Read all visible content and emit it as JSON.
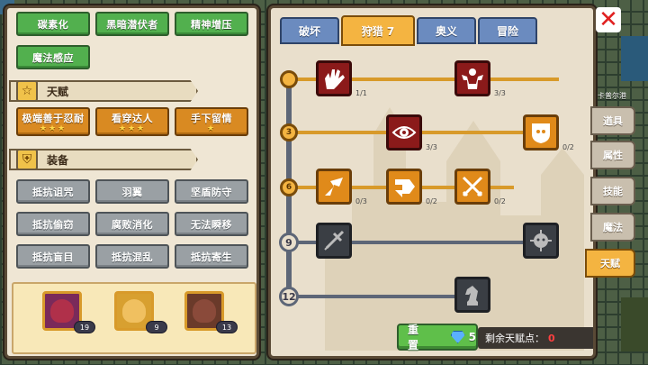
{
  "skills_top": [
    "碳素化",
    "黑暗潜伏者",
    "精神增压",
    "魔法感应"
  ],
  "talent_section": {
    "title": "天赋",
    "items": [
      {
        "label": "极端善于忍耐",
        "stars": "★★★"
      },
      {
        "label": "看穿达人",
        "stars": "★★★"
      },
      {
        "label": "手下留情",
        "stars": "★"
      }
    ]
  },
  "equip_section": {
    "title": "装备",
    "items": [
      "抵抗诅咒",
      "羽翼",
      "坚盾防守",
      "抵抗偷窃",
      "腐败消化",
      "无法瞬移",
      "抵抗盲目",
      "抵抗混乱",
      "抵抗寄生"
    ]
  },
  "heroes": [
    {
      "level": "19",
      "color": "#7a2a5a"
    },
    {
      "level": "9",
      "color": "#d8a030"
    },
    {
      "level": "13",
      "color": "#6a3a2a"
    }
  ],
  "tabs": [
    "破坏",
    "狩猎 7",
    "奥义",
    "冒险"
  ],
  "active_tab": "狩猎 7",
  "tiers": [
    "",
    "3",
    "6",
    "9",
    "12"
  ],
  "skill_ranks": {
    "t0a": "1/1",
    "t0b": "3/3",
    "t1a": "3/3",
    "t1b": "0/2",
    "t2a": "0/3",
    "t2b": "0/2",
    "t2c": "0/2"
  },
  "reset": {
    "label": "重置",
    "cost": "5"
  },
  "remaining": {
    "label": "剩余天赋点：",
    "value": "0"
  },
  "side_tabs": [
    "道具",
    "属性",
    "技能",
    "魔法",
    "天赋"
  ],
  "side_active": "天赋",
  "map_label": "卡普尔港",
  "colors": {
    "accent": "#f4b441",
    "green": "#52b04e",
    "close": "#e02020"
  }
}
